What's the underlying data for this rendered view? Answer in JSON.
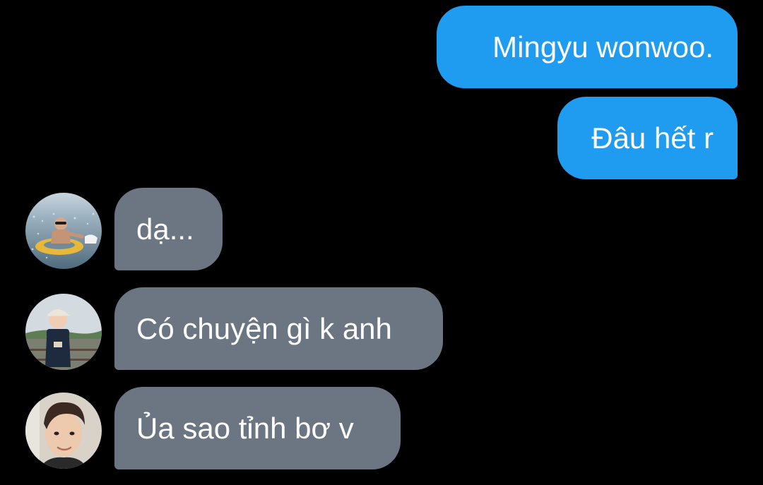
{
  "conversation": {
    "messages": [
      {
        "direction": "outgoing",
        "text": "Mingyu wonwoo."
      },
      {
        "direction": "outgoing",
        "text": "Đâu hết r"
      },
      {
        "direction": "incoming",
        "avatar": "avatar-photo-swim-ring",
        "text": "dạ..."
      },
      {
        "direction": "incoming",
        "avatar": "avatar-photo-child-cap",
        "text": "Có chuyện gì k anh"
      },
      {
        "direction": "incoming",
        "avatar": "avatar-photo-portrait",
        "text": "Ủa sao tỉnh bơ v"
      }
    ]
  },
  "colors": {
    "background": "#000000",
    "outgoing_bubble": "#1f9bf0",
    "incoming_bubble": "#6b7682",
    "text": "#ffffff"
  }
}
